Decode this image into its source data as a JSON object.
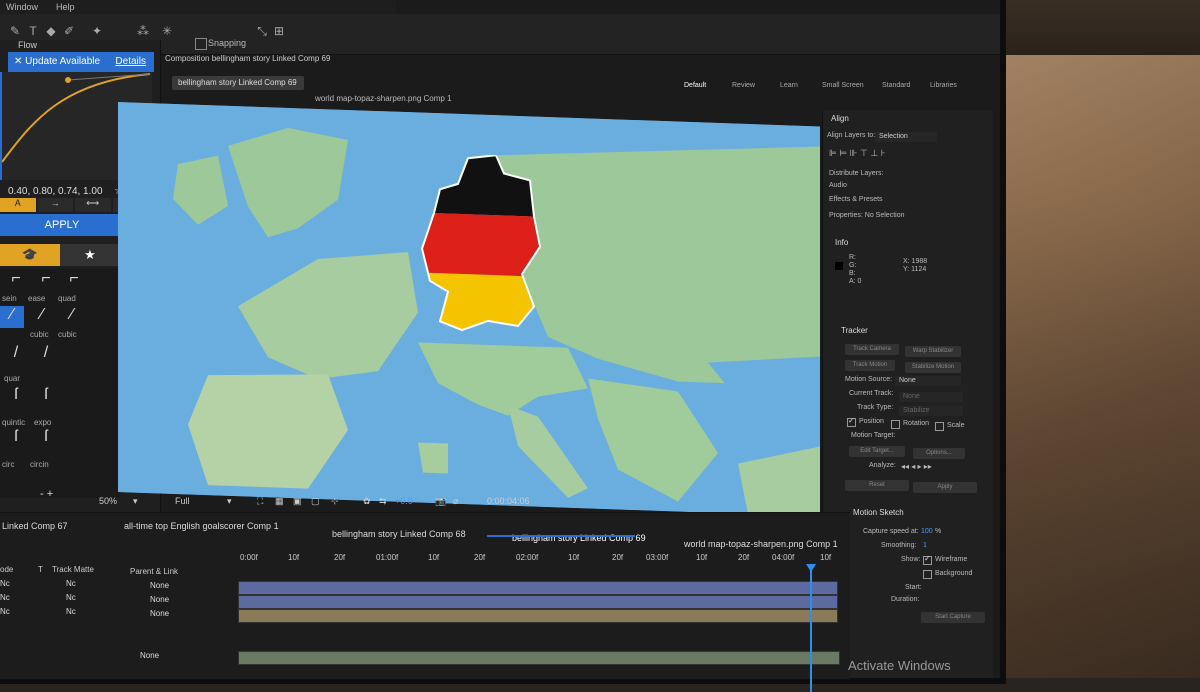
{
  "menu": {
    "items": [
      "Window",
      "Help"
    ]
  },
  "toolbar": {
    "snapping_label": "Snapping"
  },
  "flow": {
    "tab_label": "Flow",
    "update_text": "Update Available",
    "details_link": "Details",
    "curve_values": "0.40, 0.80, 0.74, 1.00",
    "ease_buttons": [
      "A",
      "→",
      "⟷",
      "←"
    ],
    "apply_label": "APPLY",
    "ease_labels": [
      "sein",
      "ease",
      "quad",
      "cubic",
      "cubic",
      "quar",
      "quintic",
      "expo",
      "circ",
      "circin"
    ],
    "minus_plus": "-  +"
  },
  "composition": {
    "header": "Composition bellingham story Linked Comp 69",
    "tab_active": "bellingham story Linked Comp 69",
    "tab_other": "world map-topaz-sharpen.png Comp 1"
  },
  "workspaces": [
    "Default",
    "Review",
    "Learn",
    "Small Screen",
    "Standard",
    "Libraries"
  ],
  "viewer": {
    "zoom": "50%",
    "resolution": "Full",
    "exposure": "+0.0",
    "timecode": "0:00:04:06"
  },
  "align": {
    "title": "Align",
    "align_layers_to_label": "Align Layers to:",
    "align_layers_to_value": "Selection",
    "distribute_label": "Distribute Layers:",
    "audio_label": "Audio",
    "effects_label": "Effects & Presets",
    "properties_label": "Properties: No Selection"
  },
  "info": {
    "title": "Info",
    "r": "R:",
    "g": "G:",
    "b": "B:",
    "a": "A: 0",
    "x": "X: 1988",
    "y": "Y: 1124"
  },
  "tracker": {
    "title": "Tracker",
    "track_camera": "Track Camera",
    "warp_stabilizer": "Warp Stabilizer",
    "track_motion": "Track Motion",
    "stabilize_motion": "Stabilize Motion",
    "motion_source_label": "Motion Source:",
    "motion_source_value": "None",
    "current_track_label": "Current Track:",
    "current_track_value": "None",
    "track_type_label": "Track Type:",
    "track_type_value": "Stabilize",
    "position": "Position",
    "rotation": "Rotation",
    "scale": "Scale",
    "motion_target": "Motion Target:",
    "edit_target": "Edit Target...",
    "options": "Options...",
    "analyze": "Analyze:",
    "reset": "Reset",
    "apply": "Apply"
  },
  "motion_sketch": {
    "title": "Motion Sketch",
    "capture_label": "Capture speed at:",
    "capture_value": "100",
    "capture_unit": "%",
    "smoothing_label": "Smoothing:",
    "smoothing_value": "1",
    "show_label": "Show:",
    "wireframe": "Wireframe",
    "background": "Background",
    "start_label": "Start:",
    "duration_label": "Duration:",
    "start_capture": "Start Capture"
  },
  "timeline": {
    "tabs": [
      "Linked Comp 67",
      "all-time top English goalscorer Comp 1",
      "bellingham story Linked Comp 68",
      "bellingham story Linked Comp 69",
      "world map-topaz-sharpen.png Comp 1"
    ],
    "col_mode": "ode",
    "col_t": "T",
    "col_track_matte": "Track Matte",
    "col_parent": "Parent & Link",
    "rows": [
      {
        "mode": "Nc",
        "matte": "Nc",
        "parent": "None"
      },
      {
        "mode": "Nc",
        "matte": "Nc",
        "parent": "None"
      },
      {
        "mode": "Nc",
        "matte": "Nc",
        "parent": "None"
      },
      {
        "parent": "None"
      }
    ],
    "ruler": [
      "0:00f",
      "10f",
      "20f",
      "01:00f",
      "10f",
      "20f",
      "02:00f",
      "10f",
      "20f",
      "03:00f",
      "10f",
      "20f",
      "04:00f",
      "10f"
    ]
  },
  "watermark": "Activate Windows"
}
